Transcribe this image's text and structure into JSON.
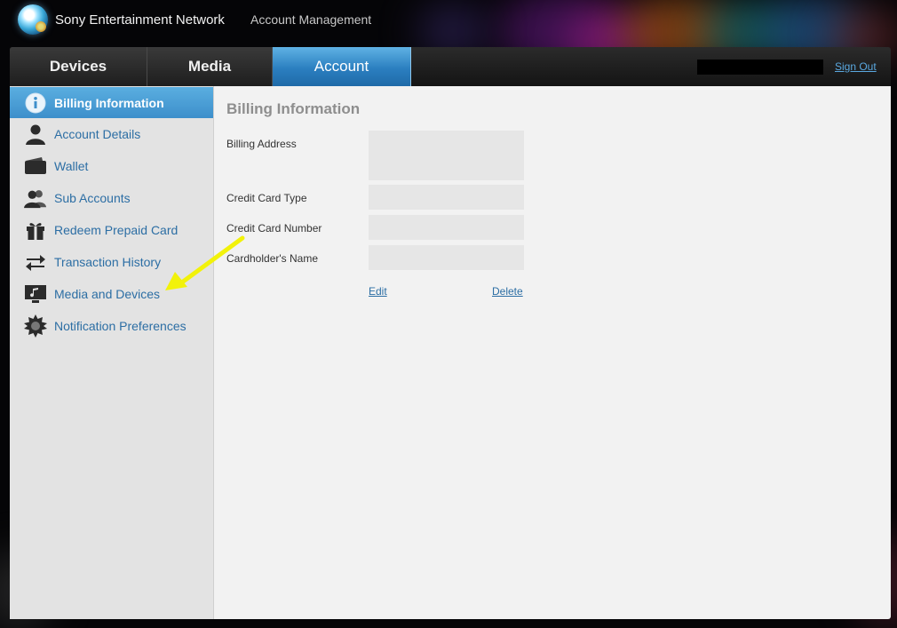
{
  "header": {
    "brand": "Sony Entertainment Network",
    "section": "Account Management"
  },
  "tabs": [
    {
      "label": "Devices"
    },
    {
      "label": "Media"
    },
    {
      "label": "Account"
    }
  ],
  "signout_label": "Sign Out",
  "sidebar": {
    "items": [
      {
        "label": "Billing Information",
        "icon": "info-icon"
      },
      {
        "label": "Account Details",
        "icon": "person-icon"
      },
      {
        "label": "Wallet",
        "icon": "wallet-icon"
      },
      {
        "label": "Sub Accounts",
        "icon": "people-icon"
      },
      {
        "label": "Redeem Prepaid Card",
        "icon": "gift-icon"
      },
      {
        "label": "Transaction History",
        "icon": "arrows-icon"
      },
      {
        "label": "Media and Devices",
        "icon": "music-monitor-icon"
      },
      {
        "label": "Notification Preferences",
        "icon": "badge-icon"
      }
    ]
  },
  "billing": {
    "title": "Billing Information",
    "address_label": "Billing Address",
    "card_type_label": "Credit Card Type",
    "card_number_label": "Credit Card Number",
    "cardholder_label": "Cardholder's Name",
    "edit_label": "Edit",
    "delete_label": "Delete"
  },
  "colors": {
    "accent": "#3d8fcb",
    "link": "#2c6ea4",
    "annotation_arrow": "#f2f20a"
  }
}
